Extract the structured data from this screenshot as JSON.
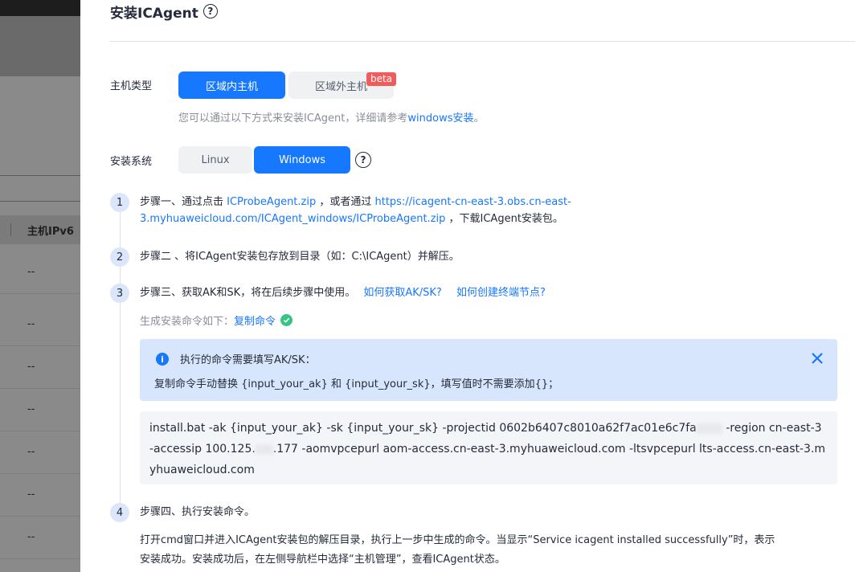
{
  "background": {
    "column_header": "主机IPv6",
    "rows": [
      "--",
      "--",
      "--",
      "--",
      "--",
      "--",
      "--"
    ]
  },
  "drawer": {
    "title": "安装ICAgent",
    "title_help": "?"
  },
  "host_type": {
    "label": "主机类型",
    "options": [
      "区域内主机",
      "区域外主机"
    ],
    "selected": "区域内主机",
    "beta_badge": "beta"
  },
  "hint": {
    "prefix": "您可以通过以下方式来安装ICAgent，详细请参考",
    "link": "windows安装",
    "suffix": "。"
  },
  "install_system": {
    "label": "安装系统",
    "options": [
      "Linux",
      "Windows"
    ],
    "selected": "Windows",
    "help": "?"
  },
  "steps": [
    {
      "number": "1",
      "text_prefix": "步骤一、通过点击 ",
      "link1": "ICProbeAgent.zip",
      "text_mid": " ，或者通过 ",
      "link2_line1": "https://icagent-cn-east-3.obs.cn-east-",
      "link2_line2": "3.myhuaweicloud.com/ICAgent_windows/ICProbeAgent.zip",
      "text_suffix": " ，下载ICAgent安装包。"
    },
    {
      "number": "2",
      "text": "步骤二 、将ICAgent安装包存放到目录（如：C:\\ICAgent）并解压。"
    },
    {
      "number": "3",
      "text": "步骤三、获取AK和SK，将在后续步骤中使用。",
      "link1": "如何获取AK/SK?",
      "link2": "如何创建终端节点?",
      "sub_label": "生成安装命令如下：",
      "copy_link": "复制命令"
    },
    {
      "number": "4",
      "text": "步骤四、执行安装命令。",
      "desc_line1": "打开cmd窗口并进入ICAgent安装包的解压目录，执行上一步中生成的命令。当显示“Service icagent installed successfully”时，表示",
      "desc_line2": "安装成功。安装成功后，在左侧导航栏中选择“主机管理”，查看ICAgent状态。"
    }
  ],
  "info": {
    "title": "执行的命令需要填写AK/SK：",
    "body": "复制命令手动替换 {input_your_ak} 和 {input_your_sk}，填写值时不需要添加{}；"
  },
  "command": {
    "part1": "install.bat -ak {input_your_ak} -sk {input_your_sk} -projectid 0602b6407c8010a62f7ac01e6c7fa",
    "part2": " -region cn-east-3 -accessip 100.125.",
    "part3": ".177 -aomvpcepurl aom-access.cn-east-3.myhuaweicloud.com -ltsvpcepurl lts-access.cn-east-3.myhuaweicloud.com"
  },
  "colors": {
    "primary": "#1677ff",
    "info_bg": "#d8e6fd",
    "beta": "#f05b5b",
    "success": "#37c486"
  }
}
